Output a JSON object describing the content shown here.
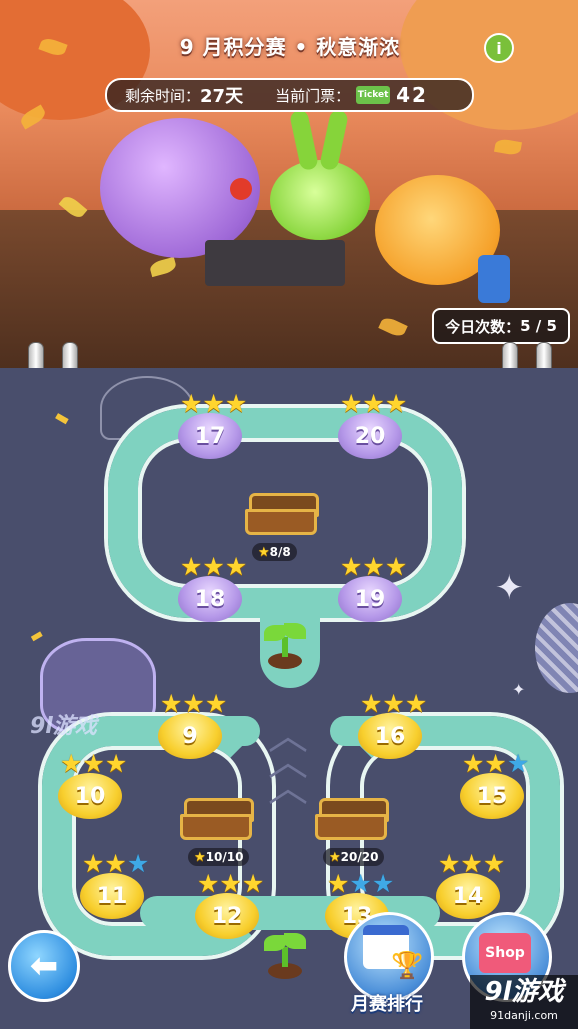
{
  "header": {
    "title": "9 月积分赛 • 秋意渐浓",
    "remaining_label": "剩余时间：",
    "remaining_value": "27天",
    "ticket_label": "当前门票：",
    "ticket_icon_text": "Ticket",
    "ticket_value": "42",
    "info_button": "i",
    "today_label": "今日次数：",
    "today_value": "5 / 5"
  },
  "levels": [
    {
      "num": "17",
      "style": "purple",
      "stars": 3
    },
    {
      "num": "20",
      "style": "purple",
      "stars": 3
    },
    {
      "num": "18",
      "style": "purple",
      "stars": 3
    },
    {
      "num": "19",
      "style": "purple",
      "stars": 3
    },
    {
      "num": "9",
      "style": "gold",
      "stars": 3
    },
    {
      "num": "16",
      "style": "gold",
      "stars": 3
    },
    {
      "num": "10",
      "style": "gold",
      "stars": 3
    },
    {
      "num": "15",
      "style": "gold",
      "stars": 2
    },
    {
      "num": "11",
      "style": "gold",
      "stars": 2
    },
    {
      "num": "12",
      "style": "gold",
      "stars": 3
    },
    {
      "num": "13",
      "style": "gold",
      "stars": 1
    },
    {
      "num": "14",
      "style": "gold",
      "stars": 3
    }
  ],
  "chests": [
    {
      "label": "8/8"
    },
    {
      "label": "10/10"
    },
    {
      "label": "20/20"
    }
  ],
  "bottom": {
    "ranking_label": "月赛排行",
    "shop_label": "Shop",
    "watermark_site": "91danji.com",
    "watermark_brand": "游戏",
    "watermark_num": "9l"
  },
  "colors": {
    "road": "#7fd2c0",
    "map_bg": "#494e6c",
    "star_gold": "#ffd52e",
    "star_blue": "#3fa9e6"
  }
}
